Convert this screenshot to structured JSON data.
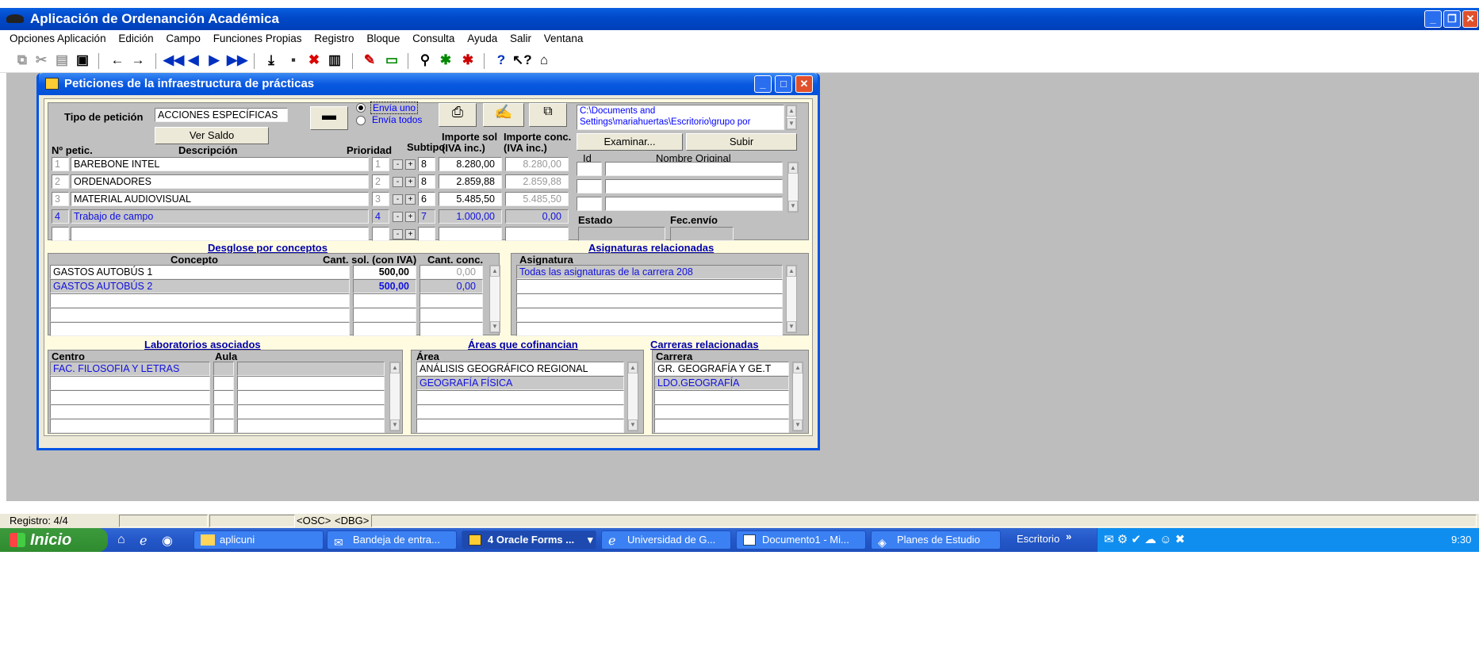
{
  "app": {
    "title": "Aplicación de Ordenanción Académica"
  },
  "menu": [
    "Opciones Aplicación",
    "Edición",
    "Campo",
    "Funciones Propias",
    "Registro",
    "Bloque",
    "Consulta",
    "Ayuda",
    "Salir",
    "Ventana"
  ],
  "window": {
    "title": "Peticiones de la infraestructura de prácticas"
  },
  "form": {
    "tipo_label": "Tipo de petición",
    "tipo_value": "ACCIONES ESPECÍFICAS",
    "ver_saldo": "Ver Saldo",
    "envia_uno": "Envía uno",
    "envia_todos": "Envía todos",
    "path": "C:\\Documents and Settings\\mariahuertas\\Escritorio\\grupo por",
    "examinar": "Examinar...",
    "subir": "Subir",
    "col_num": "Nº petic.",
    "col_desc": "Descripción",
    "col_prio": "Prioridad",
    "col_sub": "Subtipo",
    "col_imp_sol": "Importe sol (IVA inc.)",
    "col_imp_conc": "Importe conc. (IVA inc.)",
    "col_id": "Id",
    "col_nombre": "Nombre Original",
    "estado": "Estado",
    "fec_envio": "Fec.envío",
    "rows": [
      {
        "n": "1",
        "desc": "BAREBONE INTEL",
        "prio": "1",
        "sub": "8",
        "sol": "8.280,00",
        "conc": "8.280,00"
      },
      {
        "n": "2",
        "desc": "ORDENADORES",
        "prio": "2",
        "sub": "8",
        "sol": "2.859,88",
        "conc": "2.859,88"
      },
      {
        "n": "3",
        "desc": "MATERIAL AUDIOVISUAL",
        "prio": "3",
        "sub": "6",
        "sol": "5.485,50",
        "conc": "5.485,50"
      },
      {
        "n": "4",
        "desc": "Trabajo de campo",
        "prio": "4",
        "sub": "7",
        "sol": "1.000,00",
        "conc": "0,00"
      }
    ]
  },
  "desglose": {
    "title": "Desglose por conceptos",
    "col_concepto": "Concepto",
    "col_sol": "Cant. sol. (con IVA)",
    "col_conc": "Cant. conc.",
    "rows": [
      {
        "c": "GASTOS AUTOBÚS 1",
        "sol": "500,00",
        "conc": "0,00"
      },
      {
        "c": "GASTOS AUTOBÚS 2",
        "sol": "500,00",
        "conc": "0,00"
      }
    ]
  },
  "asignaturas": {
    "title": "Asignaturas relacionadas",
    "col": "Asignatura",
    "rows": [
      "Todas las asignaturas de la carrera 208"
    ]
  },
  "labs": {
    "title": "Laboratorios asociados",
    "col_centro": "Centro",
    "col_aula": "Aula",
    "rows": [
      "FAC. FILOSOFIA Y LETRAS"
    ]
  },
  "areas": {
    "title": "Áreas que cofinancian",
    "col": "Área",
    "rows": [
      "ANÁLISIS GEOGRÁFICO REGIONAL",
      "GEOGRAFÍA FÍSICA"
    ]
  },
  "carreras": {
    "title": "Carreras relacionadas",
    "col": "Carrera",
    "rows": [
      "GR. GEOGRAFÍA Y GE.T",
      "LDO.GEOGRAFÍA"
    ]
  },
  "status": {
    "registro": "Registro: 4/4",
    "osc": "<OSC>",
    "dbg": "<DBG>"
  },
  "taskbar": {
    "start": "Inicio",
    "tasks": [
      "aplicuni",
      "Bandeja de entra...",
      "4 Oracle Forms ...",
      "Universidad de G...",
      "Documento1 - Mi...",
      "Planes de Estudio"
    ],
    "escritorio": "Escritorio",
    "clock": "9:30"
  },
  "colors": {
    "titlebar": "#0054e3",
    "canvas": "#fffbe0",
    "panel": "#c0c0c0",
    "selected_text": "#1010e0",
    "taskbar": "#2457c8",
    "start": "#3c9a3c"
  }
}
